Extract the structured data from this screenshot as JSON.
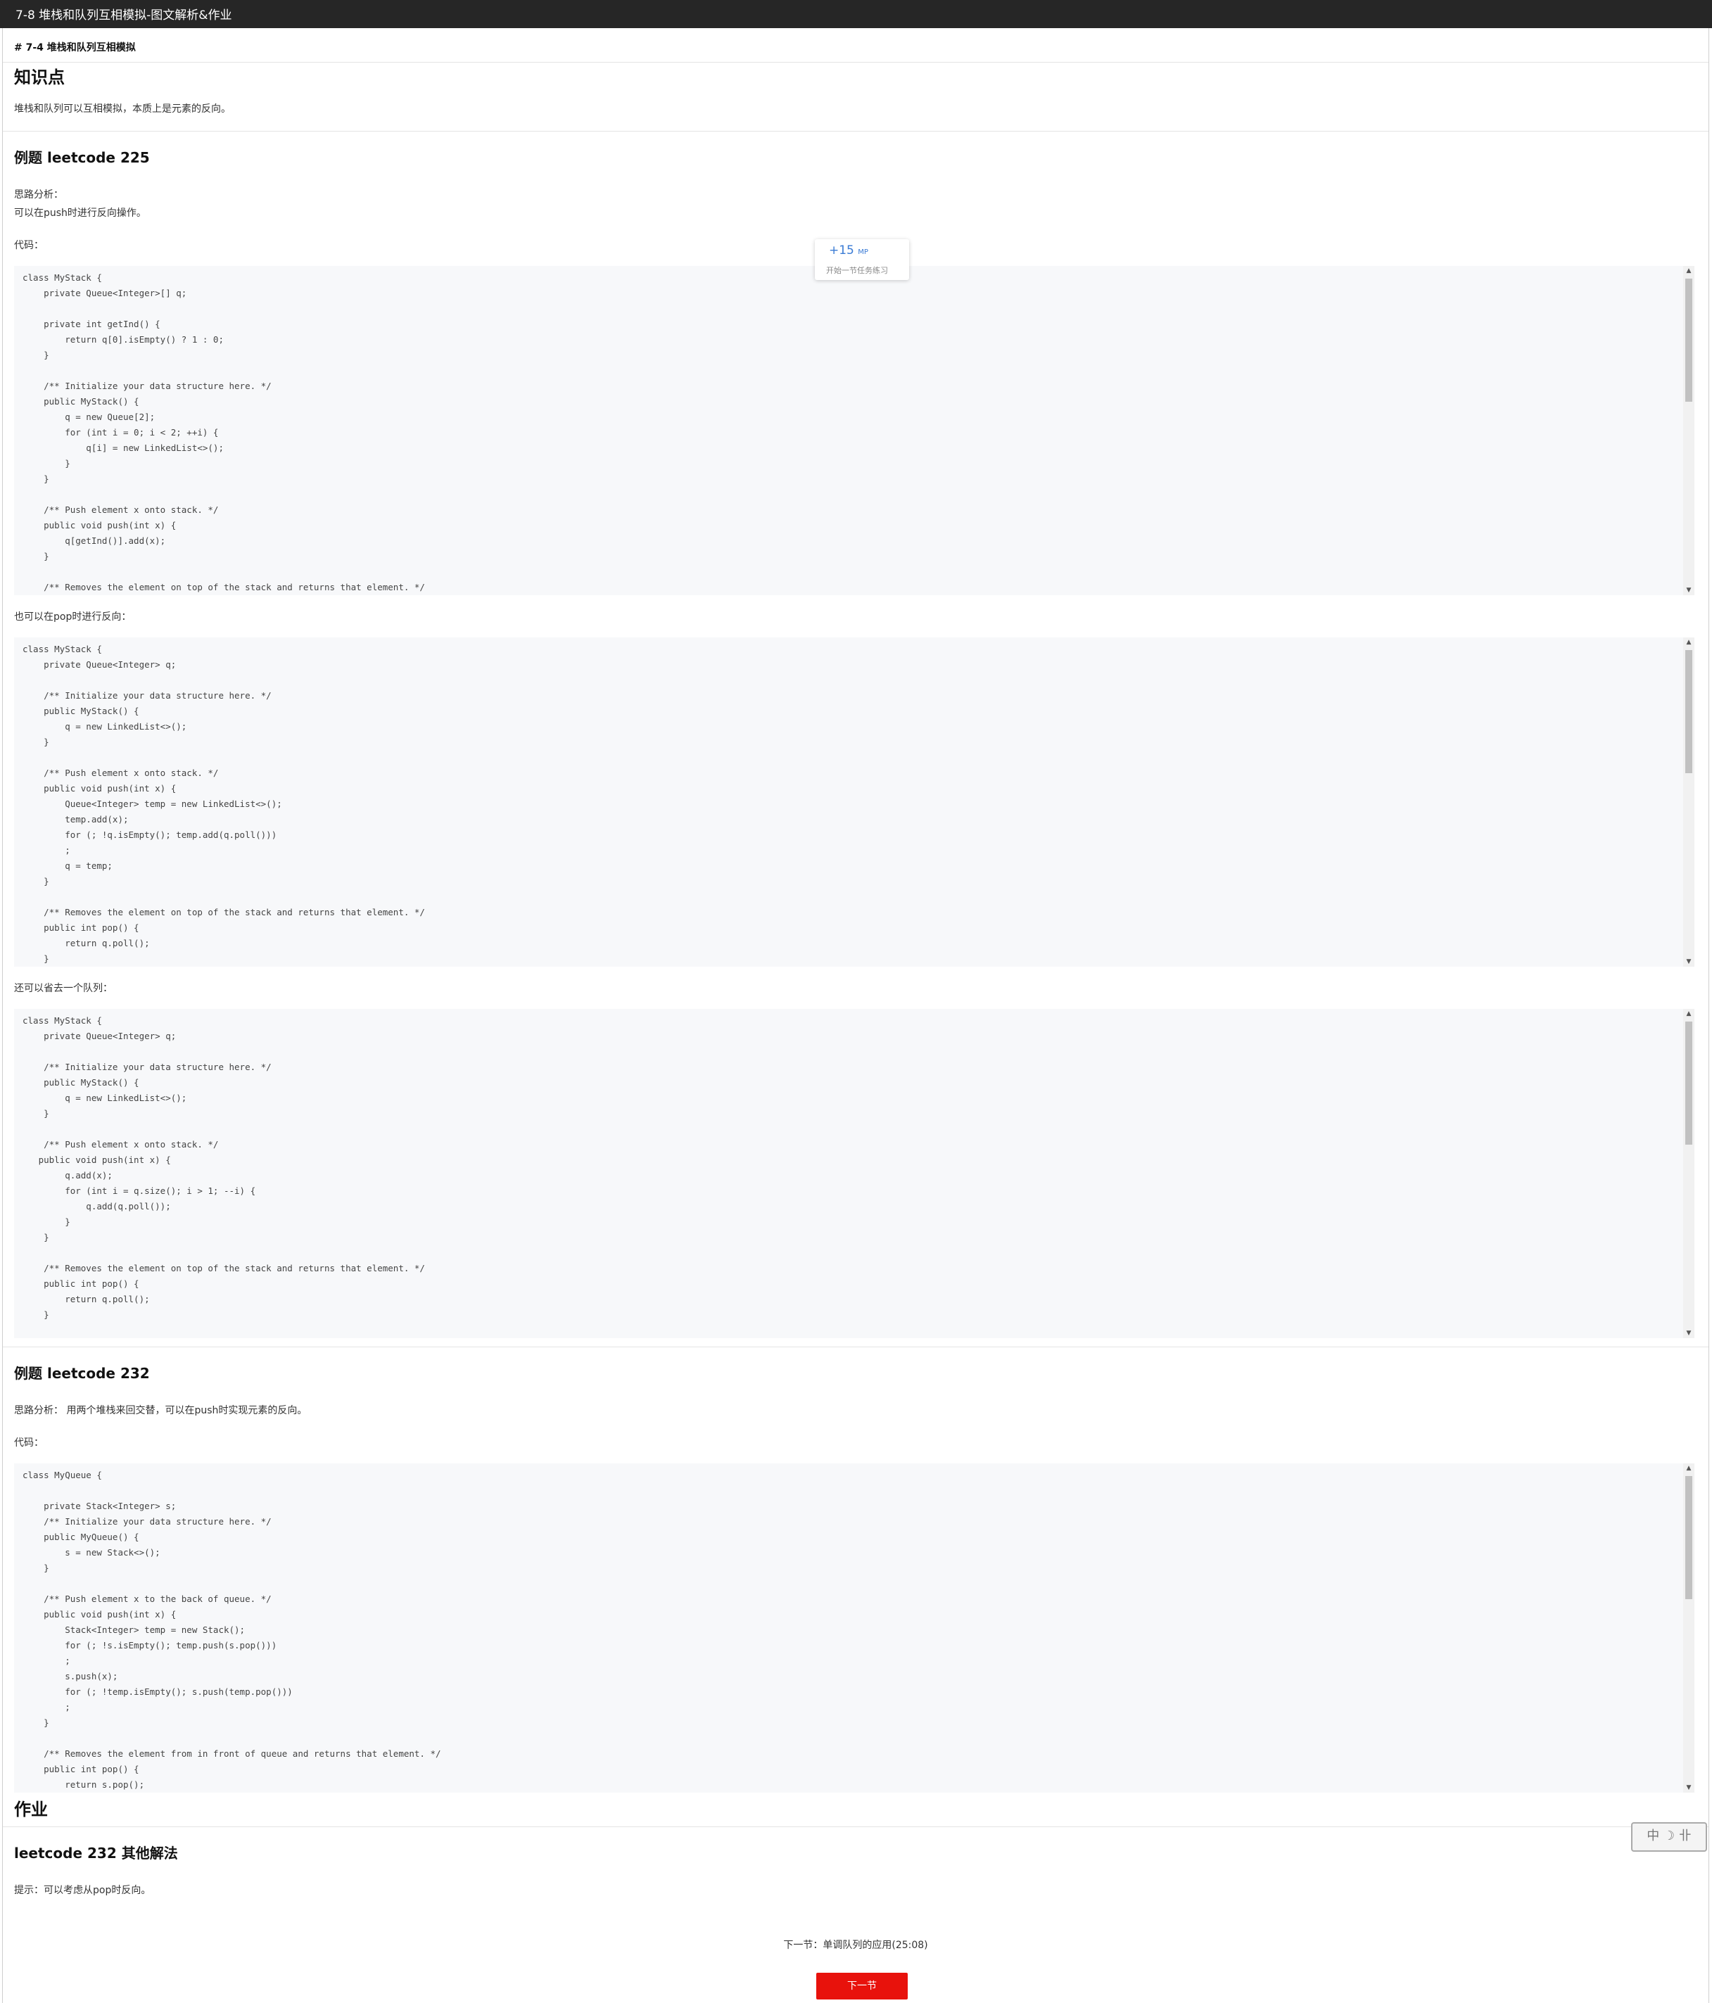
{
  "window": {
    "title": "7-8 堆栈和队列互相模拟-图文解析&作业"
  },
  "breadcrumb": "# 7-4 堆栈和队列互相模拟",
  "section1": {
    "heading": "知识点",
    "text": "堆栈和队列可以互相模拟，本质上是元素的反向。"
  },
  "example225": {
    "heading": "例题 leetcode 225",
    "analysis_label": "思路分析：",
    "analysis_text": "可以在push时进行反向操作。",
    "code_label": "代码：",
    "code1": "class MyStack {\n    private Queue<Integer>[] q;\n\n    private int getInd() {\n        return q[0].isEmpty() ? 1 : 0;\n    }\n\n    /** Initialize your data structure here. */\n    public MyStack() {\n        q = new Queue[2];\n        for (int i = 0; i < 2; ++i) {\n            q[i] = new LinkedList<>();\n        }\n    }\n\n    /** Push element x onto stack. */\n    public void push(int x) {\n        q[getInd()].add(x);\n    }\n\n    /** Removes the element on top of the stack and returns that element. */",
    "pop_text": "也可以在pop时进行反向：",
    "code2": "class MyStack {\n    private Queue<Integer> q;\n\n    /** Initialize your data structure here. */\n    public MyStack() {\n        q = new LinkedList<>();\n    }\n\n    /** Push element x onto stack. */\n    public void push(int x) {\n        Queue<Integer> temp = new LinkedList<>();\n        temp.add(x);\n        for (; !q.isEmpty(); temp.add(q.poll()))\n        ;\n        q = temp;\n    }\n\n    /** Removes the element on top of the stack and returns that element. */\n    public int pop() {\n        return q.poll();\n    }",
    "save_text": "还可以省去一个队列：",
    "code3": "class MyStack {\n    private Queue<Integer> q;\n\n    /** Initialize your data structure here. */\n    public MyStack() {\n        q = new LinkedList<>();\n    }\n\n    /** Push element x onto stack. */\n   public void push(int x) {\n        q.add(x);\n        for (int i = q.size(); i > 1; --i) {\n            q.add(q.poll());\n        }\n    }\n\n    /** Removes the element on top of the stack and returns that element. */\n    public int pop() {\n        return q.poll();\n    }"
  },
  "badge": {
    "points": "+15",
    "unit": "MP",
    "subtitle": "开始一节任务练习"
  },
  "example232": {
    "heading": "例题 leetcode 232",
    "analysis": "思路分析： 用两个堆栈来回交替，可以在push时实现元素的反向。",
    "code_label": "代码：",
    "code": "class MyQueue {\n\n    private Stack<Integer> s;\n    /** Initialize your data structure here. */\n    public MyQueue() {\n        s = new Stack<>();\n    }\n\n    /** Push element x to the back of queue. */\n    public void push(int x) {\n        Stack<Integer> temp = new Stack();\n        for (; !s.isEmpty(); temp.push(s.pop()))\n        ;\n        s.push(x);\n        for (; !temp.isEmpty(); s.push(temp.pop()))\n        ;\n    }\n\n    /** Removes the element from in front of queue and returns that element. */\n    public int pop() {\n        return s.pop();"
  },
  "homework": {
    "heading": "作业",
    "subheading": "leetcode 232 其他解法",
    "hint": "提示：可以考虑从pop时反向。"
  },
  "stamp_text": "中 ☽ 卝",
  "next": {
    "text": "下一节：单调队列的应用(25:08)",
    "button": "下一节"
  }
}
